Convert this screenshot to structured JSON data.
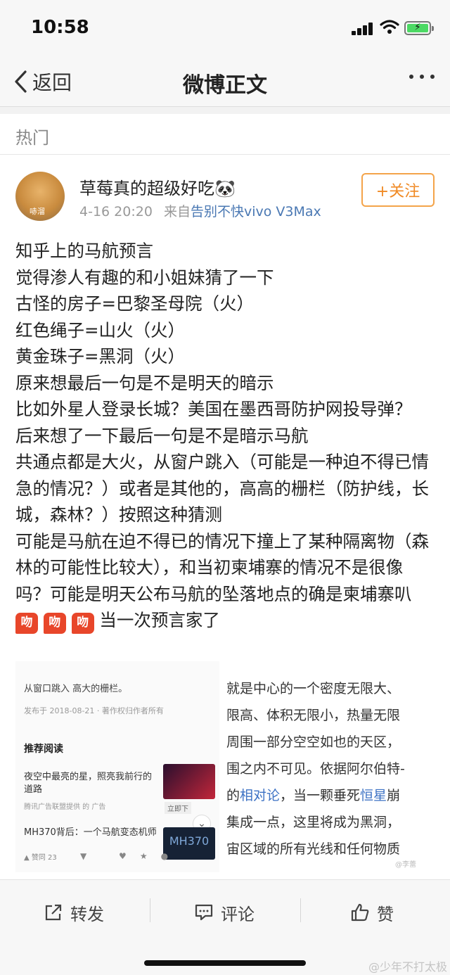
{
  "status": {
    "time": "10:58"
  },
  "nav": {
    "back_label": "返回",
    "title": "微博正文"
  },
  "section": {
    "label": "热门"
  },
  "post": {
    "username": "草莓真的超级好吃🐼",
    "avatar_tag": "哧溜",
    "timestamp": "4-16 20:20",
    "source_prefix": "来自",
    "source": "告别不快vivo V3Max",
    "follow_label": "+关注",
    "lines": [
      "知乎上的马航预言",
      "觉得渗人有趣的和小姐妹猜了一下",
      "古怪的房子=巴黎圣母院（火）",
      "红色绳子=山火（火）",
      "黄金珠子=黑洞（火）",
      "原来想最后一句是不是明天的暗示",
      "比如外星人登录长城？美国在墨西哥防护网投导弹？",
      "后来想了一下最后一句是不是暗示马航"
    ],
    "para1": "共通点都是大火，从窗户跳入（可能是一种迫不得已情急的情况？）或者是其他的，高高的栅栏（防护线，长城，森林？）按照这种猜测",
    "para2": "可能是马航在迫不得已的情况下撞上了某种隔离物（森林的可能性比较大），和当初柬埔寨的情况不是很像吗？可能是明天公布马航的坠落地点的确是柬埔寨叭",
    "emoji_glyph": "吻",
    "emoji_text": "当一次预言家了"
  },
  "screenshot": {
    "left": {
      "line1": "从窗口跳入 高大的栅栏。",
      "line2": "发布于 2018-08-21 · 著作权归作者所有",
      "heading": "推荐阅读",
      "article1": "夜空中最亮的星，照亮我前行的道路",
      "article1_meta": "腾讯广告联盟提供 的 广告",
      "article1_button": "立即下",
      "article2": "MH370背后：一个马航变态机师",
      "article2_thumb": "MH370",
      "vote": "▲ 赞同 23"
    },
    "right": {
      "lines": [
        "就是中心的一个密度无限大、",
        "限高、体积无限小，热量无限",
        "周围一部分空空如也的天区，",
        "围之内不可见。依据阿尔伯特-",
        "的相对论，当一颗垂死恒星崩",
        "集成一点，这里将成为黑洞，",
        "宙区域的所有光线和任何物质"
      ],
      "blue_words": [
        "相对论",
        "恒星"
      ]
    },
    "watermark": "@李蕾"
  },
  "actions": {
    "repost": "转发",
    "comment": "评论",
    "like": "赞"
  },
  "watermark": "@少年不打太极"
}
